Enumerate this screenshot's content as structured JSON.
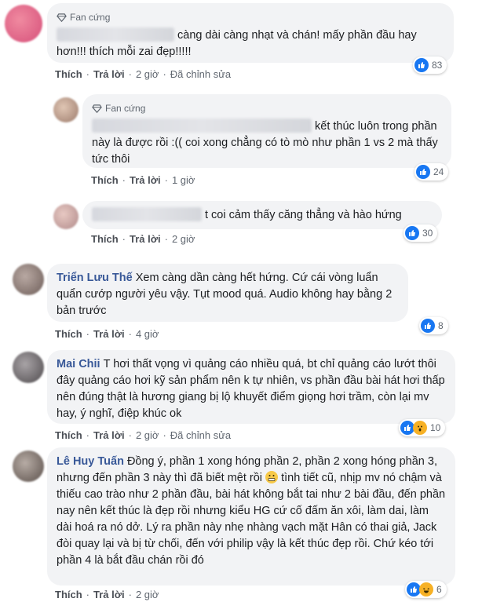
{
  "comments": [
    {
      "badge": "Fan cứng",
      "text": "càng dài càng nhạt và chán! mấy phần đầu hay hơn!!! thích mỗi zai đẹp!!!!!",
      "actions": [
        "Thích",
        "Trả lời",
        "2 giờ",
        "Đã chỉnh sửa"
      ],
      "reactions": "83"
    },
    {
      "badge": "Fan cứng",
      "text": "kết thúc luôn trong phần này là được rồi :(( coi xong chẳng có tò mò như phần 1 vs 2 mà thấy tức thôi",
      "actions": [
        "Thích",
        "Trả lời",
        "1 giờ"
      ],
      "reactions": "24"
    },
    {
      "text": "t coi cảm thấy căng thẳng và hào hứng",
      "actions": [
        "Thích",
        "Trả lời",
        "2 giờ"
      ],
      "reactions": "30"
    },
    {
      "name": "Triển Lưu Thế",
      "text": "Xem càng dần càng hết hứng. Cứ cái vòng luẩn quẩn cướp người yêu vậy. Tụt mood quá. Audio không hay bằng 2 bản trước",
      "actions": [
        "Thích",
        "Trả lời",
        "4 giờ"
      ],
      "reactions": "8"
    },
    {
      "name": "Mai Chii",
      "text": "T hơi thất vọng vì quảng cáo nhiều quá, bt chỉ quảng cáo lướt thôi đây quảng cáo hơi kỹ sản phẩm nên k tự nhiên, vs phần đầu bài hát hơi thấp nên đúng thật là hương giang bị lộ khuyết điểm giọng hơi trầm, còn lại mv hay, ý nghĩ, điệp khúc ok",
      "actions": [
        "Thích",
        "Trả lời",
        "2 giờ",
        "Đã chỉnh sửa"
      ],
      "reactions": "10"
    },
    {
      "name": "Lê Huy Tuấn",
      "text_before_emoji": "Đồng ý, phần 1 xong hóng phần 2, phần 2 xong hóng phần 3, nhưng đến phần 3 này thì đã biết mệt rồi",
      "text_after_emoji": "tình tiết cũ, nhịp mv nó chậm và thiếu cao trào như 2 phần đầu, bài hát không bắt tai như 2 bài đầu, đến phần nay nên kết thúc là đẹp rồi nhưng kiểu HG cứ cố đấm ăn xôi, làm dai, làm dài hoá ra nó dở. Lý ra phần này nhẹ nhàng vạch mặt Hân có thai giả, Jack đòi quay lại và bị từ chối, đến với philip vậy là kết thúc đẹp rồi. Chứ kéo tới phần 4 là bắt đầu chán rồi đó",
      "actions": [
        "Thích",
        "Trả lời",
        "2 giờ"
      ],
      "reactions": "6"
    }
  ],
  "colors": {
    "name": "#385898",
    "like": "#1877f2",
    "bubble": "#f2f3f5"
  }
}
